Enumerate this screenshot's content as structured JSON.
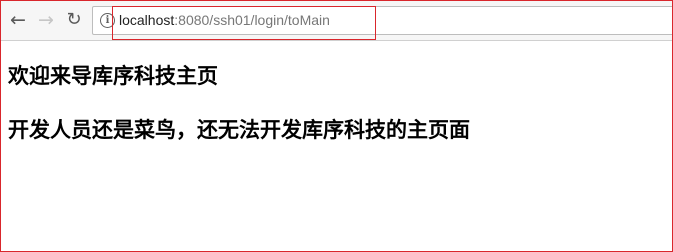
{
  "browser": {
    "icons": {
      "back": "back-arrow-icon",
      "forward": "forward-arrow-icon",
      "reload": "reload-icon",
      "info": "info-icon"
    },
    "address_bar": {
      "host": "localhost",
      "rest": ":8080/ssh01/login/toMain"
    }
  },
  "page": {
    "heading_1": "欢迎来导库序科技主页",
    "heading_2": "开发人员还是菜鸟，还无法开发库序科技的主页面"
  },
  "colors": {
    "annotation_red": "#d9262c",
    "toolbar_bg": "#f6f6f6",
    "text": "#000000"
  }
}
